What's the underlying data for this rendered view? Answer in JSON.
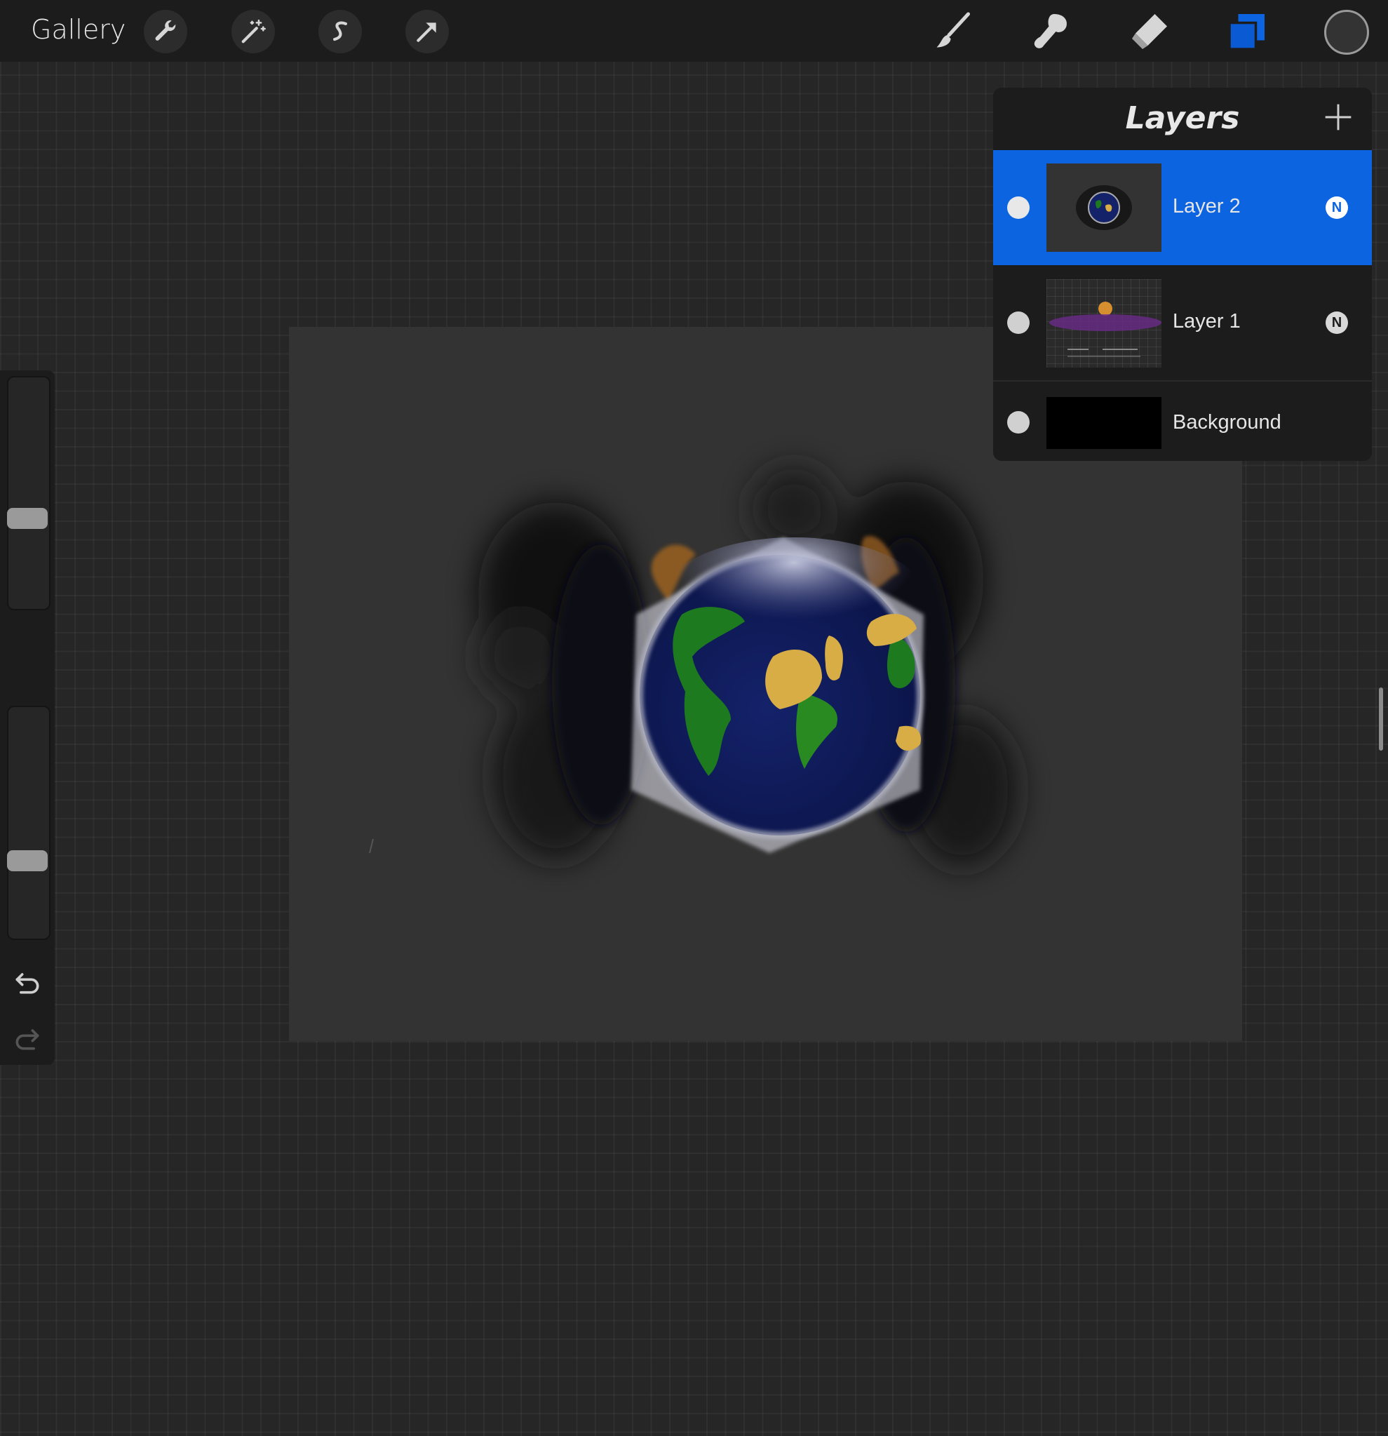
{
  "toolbar": {
    "gallery_label": "Gallery",
    "left_tools": [
      "wrench-icon",
      "magic-wand-icon",
      "selection-s-icon",
      "transform-arrow-icon"
    ],
    "right_tools": [
      "brush-icon",
      "smudge-icon",
      "eraser-icon",
      "layers-icon"
    ],
    "active_tool": "layers-icon",
    "current_color": "#333333"
  },
  "sidebar": {
    "brush_size_level": 0.62,
    "opacity_level": 0.68,
    "undo_icon": "undo-icon",
    "redo_icon": "redo-icon"
  },
  "layers_panel": {
    "title": "Layers",
    "add_icon": "plus-icon",
    "layers": [
      {
        "name": "Layer 2",
        "blend_mode": "N",
        "selected": true
      },
      {
        "name": "Layer 1",
        "blend_mode": "N",
        "selected": false
      },
      {
        "name": "Background",
        "blend_mode": "",
        "selected": false
      }
    ]
  },
  "colors": {
    "accent": "#0d64e0",
    "toolbar_bg": "#1c1c1c",
    "canvas_bg": "#333333",
    "ocean": "#101d5e",
    "land_green": "#1e7a1e",
    "land_yellow": "#d9ad46"
  }
}
